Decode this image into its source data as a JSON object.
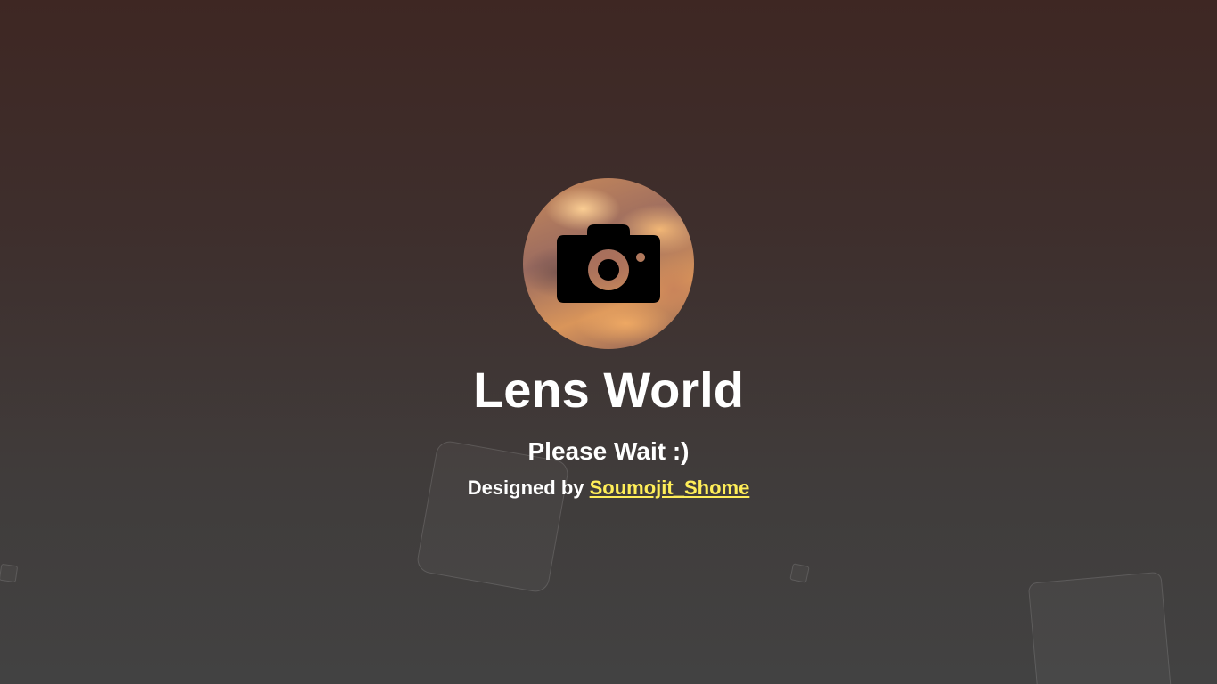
{
  "app": {
    "title": "Lens World",
    "subtitle": "Please Wait :)",
    "credit_prefix": "Designed by",
    "credit_link": "Soumojit_Shome"
  },
  "logo": {
    "icon": "camera-icon"
  },
  "colors": {
    "background_top": "#3e2723",
    "background_bottom": "#424242",
    "text": "#ffffff",
    "link": "#ffee58"
  }
}
